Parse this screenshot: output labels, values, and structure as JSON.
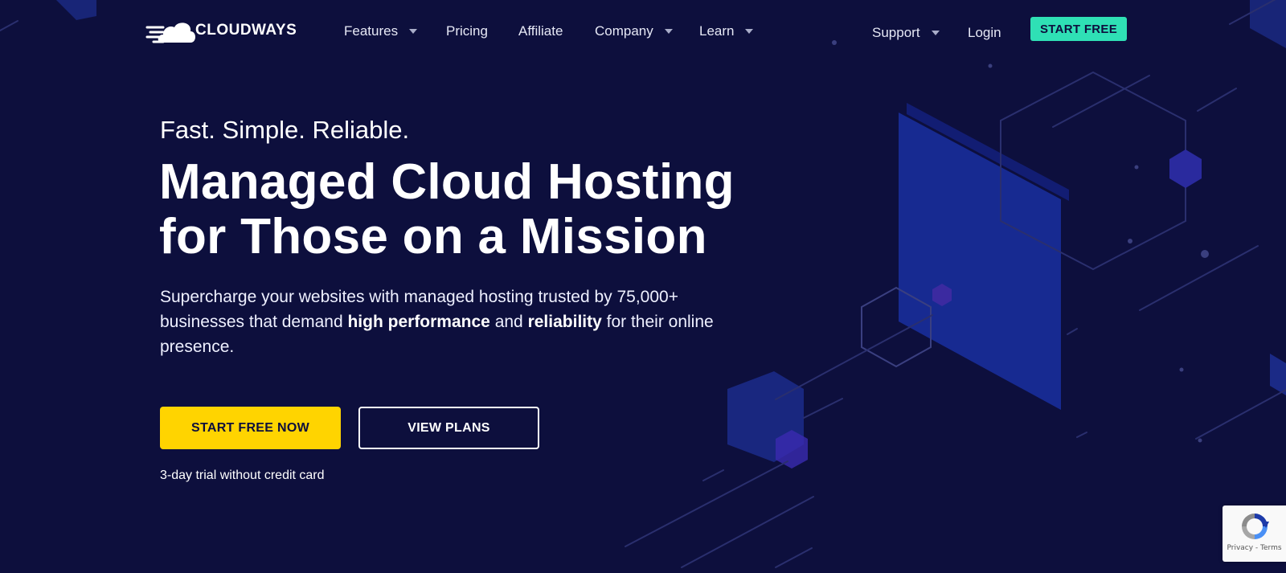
{
  "brand": {
    "name": "CLOUDWAYS"
  },
  "nav": {
    "items": [
      {
        "label": "Features",
        "has_dropdown": true
      },
      {
        "label": "Pricing",
        "has_dropdown": false
      },
      {
        "label": "Affiliate",
        "has_dropdown": false
      },
      {
        "label": "Company",
        "has_dropdown": true
      },
      {
        "label": "Learn",
        "has_dropdown": true
      }
    ],
    "support": {
      "label": "Support",
      "has_dropdown": true
    },
    "login": {
      "label": "Login"
    },
    "cta": {
      "label": "START FREE"
    }
  },
  "hero": {
    "tagline": "Fast. Simple. Reliable.",
    "headline_line1": "Managed Cloud Hosting",
    "headline_line2": "for Those on a Mission",
    "subcopy": {
      "part1": "Supercharge your websites with managed hosting trusted by 75,000+ businesses that demand ",
      "bold1": "high performance",
      "part2": " and ",
      "bold2": "reliability",
      "part3": " for their online presence."
    },
    "primary_button": "START FREE NOW",
    "secondary_button": "VIEW PLANS",
    "trial_note": "3-day trial without credit card"
  },
  "recaptcha": {
    "links": "Privacy - Terms"
  },
  "colors": {
    "background": "#0d0f3d",
    "accent_green": "#2fe0b5",
    "accent_yellow": "#ffd400",
    "panel_blue": "#13278f"
  },
  "icons": [
    "cloudways-logo-icon",
    "chevron-down-icon",
    "recaptcha-icon"
  ]
}
